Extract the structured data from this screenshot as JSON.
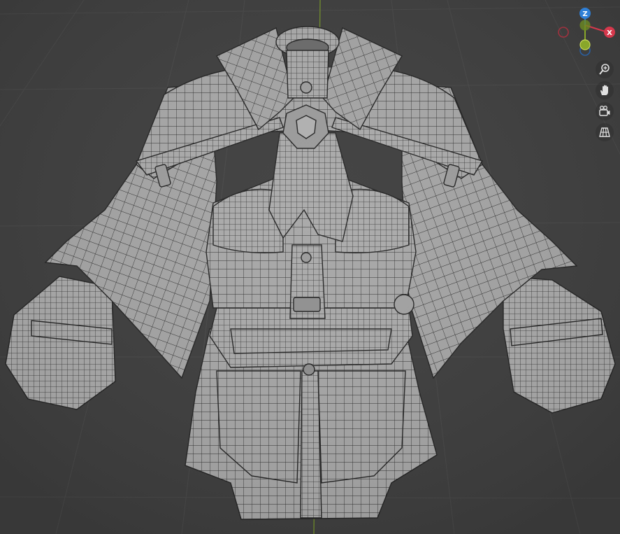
{
  "viewport": {
    "background": "#3d3d3d",
    "grid_color": "#4a4a4a",
    "y_axis_color": "#6e8a2a",
    "mesh_fill": "#a3a3a3",
    "mesh_wire": "#2a2a2a"
  },
  "gizmo": {
    "axes": [
      {
        "name": "Z",
        "label": "Z",
        "color": "#2f7fd6"
      },
      {
        "name": "X",
        "label": "X",
        "color": "#d6384c"
      },
      {
        "name": "Y",
        "label": "",
        "color": "#89a72a"
      },
      {
        "name": "-X",
        "label": "",
        "color": "#a0323f"
      },
      {
        "name": "-Y",
        "label": "",
        "color": "#6c8a22"
      },
      {
        "name": "-Z",
        "label": "",
        "color": "#2a5fa0"
      }
    ]
  },
  "navigation": [
    {
      "id": "zoom",
      "icon": "zoom-icon"
    },
    {
      "id": "pan",
      "icon": "hand-icon"
    },
    {
      "id": "camera",
      "icon": "camera-icon"
    },
    {
      "id": "perspective",
      "icon": "grid-perspective-icon"
    }
  ]
}
